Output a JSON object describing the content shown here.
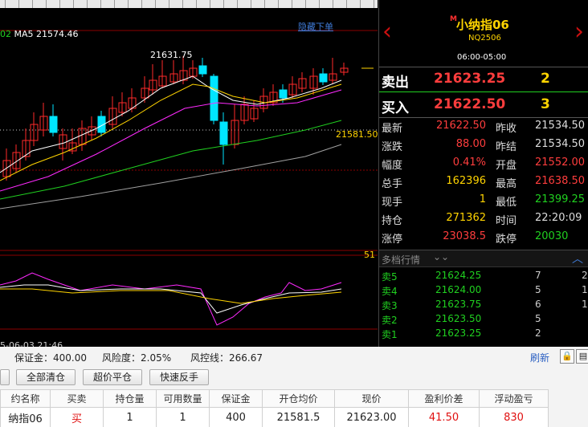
{
  "chart": {
    "ma_label_a": "02",
    "ma_label_b": "MA5",
    "ma_label_c": "21574.46",
    "hide_order": "隐藏下单",
    "high": "21631.75",
    "last_tag": "21581.50",
    "mark": "51",
    "time": "5-06-03 21:46",
    "colors": {
      "up": "#ff2a2a",
      "down": "#00e5ff",
      "ma5": "#ffffff",
      "ma10": "#ffd400",
      "ma20": "#ff2aff",
      "ma40": "#20d020",
      "ma60": "#a0a0a0"
    }
  },
  "quote": {
    "symbol": "小纳指06",
    "badge": "M",
    "code": "NQ2506",
    "session": "06:00-05:00",
    "ask_label": "卖出",
    "ask_price": "21623.25",
    "ask_vol": "2",
    "bid_label": "买入",
    "bid_price": "21622.50",
    "bid_vol": "3",
    "rows": [
      {
        "k1": "最新",
        "v1": "21622.50",
        "c1": "red",
        "k2": "昨收",
        "v2": "21534.50",
        "c2": "wht"
      },
      {
        "k1": "涨跌",
        "v1": "88.00",
        "c1": "red",
        "k2": "昨结",
        "v2": "21534.50",
        "c2": "wht"
      },
      {
        "k1": "幅度",
        "v1": "0.41%",
        "c1": "red",
        "k2": "开盘",
        "v2": "21552.00",
        "c2": "red"
      },
      {
        "k1": "总手",
        "v1": "162396",
        "c1": "yel",
        "k2": "最高",
        "v2": "21638.50",
        "c2": "red"
      },
      {
        "k1": "现手",
        "v1": "1",
        "c1": "yel",
        "k2": "最低",
        "v2": "21399.25",
        "c2": "grn"
      },
      {
        "k1": "持仓",
        "v1": "271362",
        "c1": "yel",
        "k2": "时间",
        "v2": "22:20:09",
        "c2": "wht"
      },
      {
        "k1": "涨停",
        "v1": "23038.5",
        "c1": "red",
        "k2": "跌停",
        "v2": "20030",
        "c2": "grn"
      }
    ],
    "depth_title": "多档行情",
    "depth_chevron": "⌄⌄",
    "depth": [
      {
        "l": "卖5",
        "p": "21624.25",
        "v": "7",
        "x": "2"
      },
      {
        "l": "卖4",
        "p": "21624.00",
        "v": "5",
        "x": "1"
      },
      {
        "l": "卖3",
        "p": "21623.75",
        "v": "6",
        "x": "1"
      },
      {
        "l": "卖2",
        "p": "21623.50",
        "v": "5",
        "x": ""
      },
      {
        "l": "卖1",
        "p": "21623.25",
        "v": "2",
        "x": ""
      }
    ]
  },
  "account": {
    "margin": "保证金：400.00",
    "risk": "风险度：2.05%",
    "line": "风控线：266.67",
    "refresh": "刷新"
  },
  "buttons": {
    "close_all": "全部清仓",
    "super_close": "超价平仓",
    "reverse": "快速反手"
  },
  "positions": {
    "headers": [
      "约名称",
      "买卖",
      "持仓量",
      "可用数量",
      "保证金",
      "开仓均价",
      "现价",
      "盈利价差",
      "浮动盈亏"
    ],
    "rows": [
      [
        "纳指06",
        "买",
        "1",
        "1",
        "400",
        "21581.5",
        "21623.00",
        "41.50",
        "830"
      ]
    ]
  }
}
